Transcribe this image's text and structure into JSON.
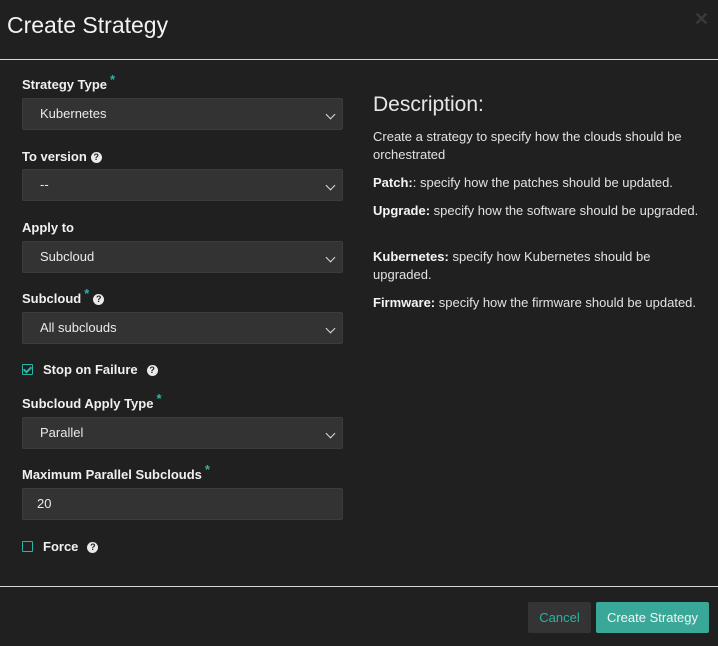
{
  "dialog": {
    "title": "Create Strategy",
    "close_glyph": "✕"
  },
  "form": {
    "strategy_type": {
      "label": "Strategy Type",
      "required": "*",
      "value": "Kubernetes"
    },
    "to_version": {
      "label": "To version",
      "help": "?",
      "value": "--"
    },
    "apply_to": {
      "label": "Apply to",
      "value": "Subcloud"
    },
    "subcloud": {
      "label": "Subcloud",
      "required": "*",
      "help": "?",
      "value": "All subclouds"
    },
    "stop_on_failure": {
      "label": "Stop on Failure",
      "help": "?",
      "checked": true
    },
    "subcloud_apply_type": {
      "label": "Subcloud Apply Type",
      "required": "*",
      "value": "Parallel"
    },
    "max_parallel": {
      "label": "Maximum Parallel Subclouds",
      "required": "*",
      "value": "20"
    },
    "force": {
      "label": "Force",
      "help": "?",
      "checked": false
    }
  },
  "description": {
    "title": "Description:",
    "intro": "Create a strategy to specify how the clouds should be orchestrated",
    "items": [
      {
        "term": "Patch:",
        "text": ": specify how the patches should be updated."
      },
      {
        "term": "Upgrade:",
        "text": " specify how the software should be upgraded."
      },
      {
        "term": "Kubernetes:",
        "text": " specify how Kubernetes should be upgraded."
      },
      {
        "term": "Firmware:",
        "text": " specify how the firmware should be updated."
      }
    ]
  },
  "footer": {
    "cancel_label": "Cancel",
    "create_label": "Create Strategy"
  },
  "colors": {
    "accent": "#2bb3a3",
    "background": "#202020",
    "field": "#333333"
  }
}
